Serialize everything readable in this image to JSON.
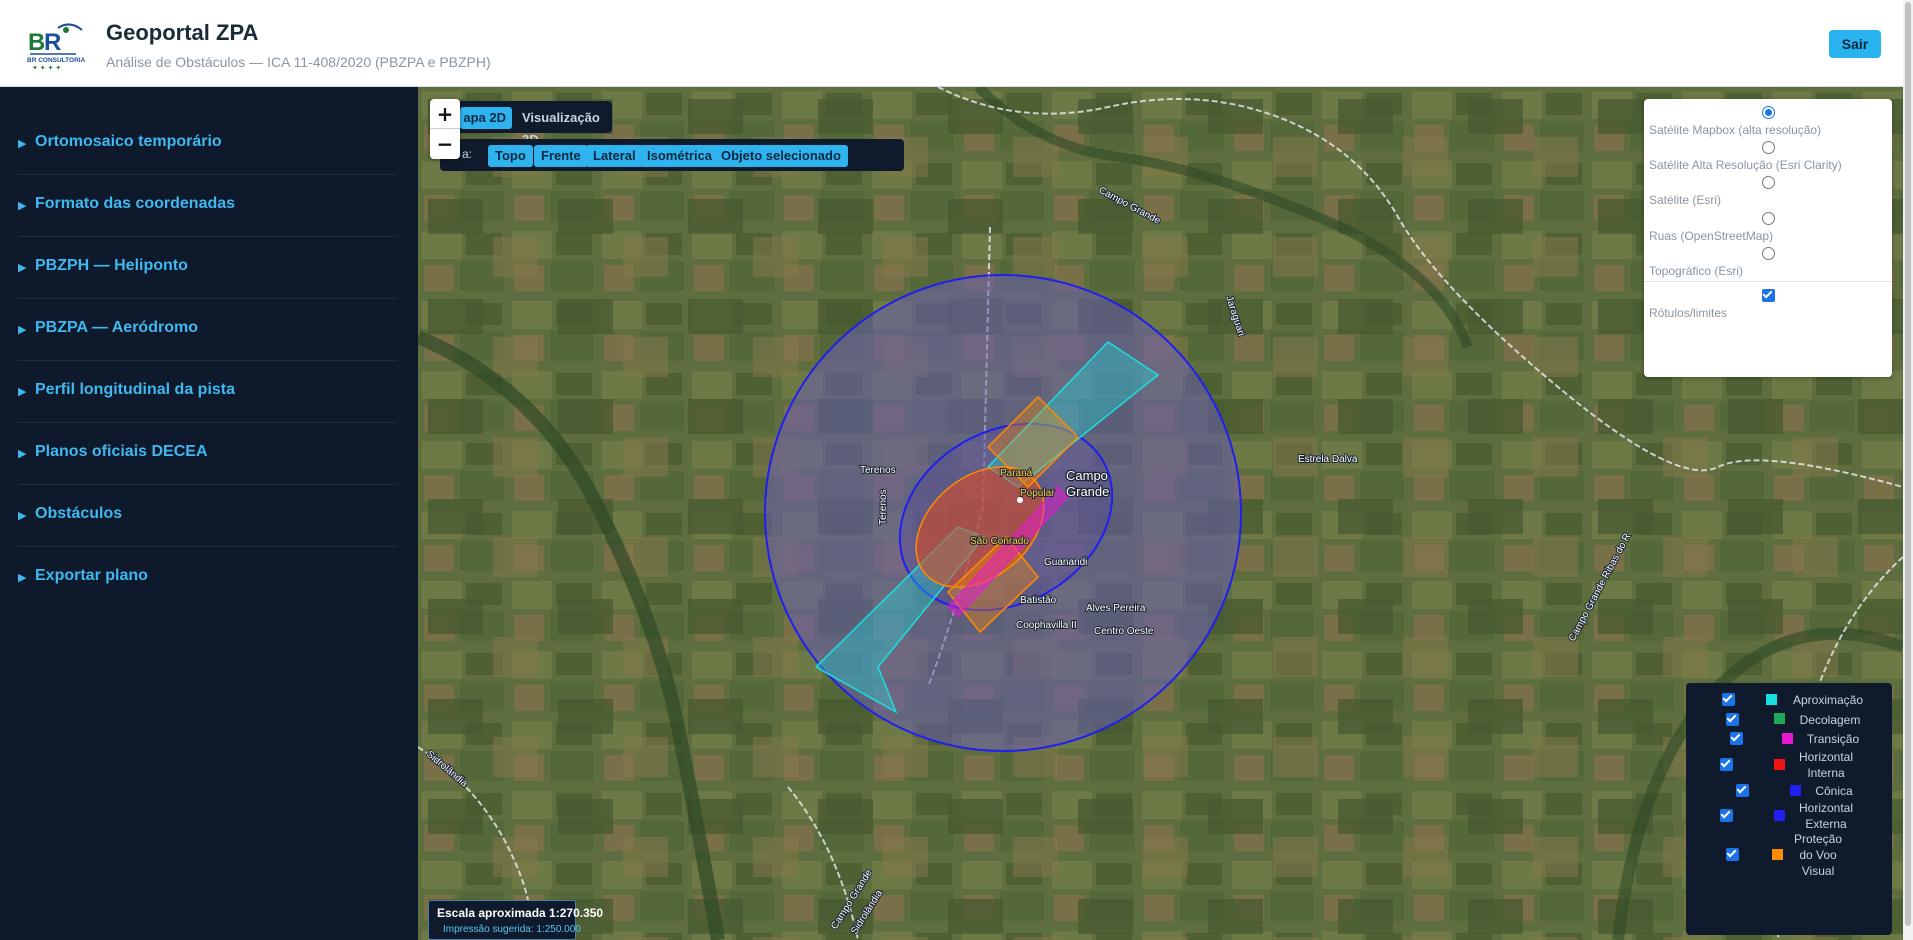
{
  "header": {
    "title": "Geoportal ZPA",
    "subtitle": "Análise de Obstáculos — ICA 11-408/2020 (PBZPA e PBZPH)",
    "logo_text": "BR CONSULTORIA",
    "logout_label": "Sair"
  },
  "sidebar": {
    "items": [
      {
        "label": "Ortomosaico temporário",
        "icon": "triangle-right-icon"
      },
      {
        "label": "Formato das coordenadas",
        "icon": "triangle-right-icon"
      },
      {
        "label": "PBZPH — Heliponto",
        "icon": "triangle-right-icon"
      },
      {
        "label": "PBZPA — Aeródromo",
        "icon": "triangle-right-icon"
      },
      {
        "label": "Perfil longitudinal da pista",
        "icon": "triangle-right-icon"
      },
      {
        "label": "Planos oficiais DECEA",
        "icon": "triangle-right-icon"
      },
      {
        "label": "Obstáculos",
        "icon": "triangle-right-icon"
      },
      {
        "label": "Exportar plano",
        "icon": "triangle-right-icon"
      }
    ]
  },
  "map": {
    "zoom_in": "+",
    "zoom_out": "−",
    "view_tabs": {
      "tab_2d": "apa 2D",
      "tab_3d": "Visualização 3D",
      "active": "2D"
    },
    "camera": {
      "prefix": "a:",
      "buttons": [
        "Topo",
        "Frente",
        "Lateral",
        "Isométrica",
        "Objeto selecionado"
      ]
    },
    "basemap": {
      "options": [
        {
          "label": "Satélite Mapbox (alta resolução)",
          "selected": true
        },
        {
          "label": "Satélite Alta Resolução (Esri Clarity)",
          "selected": false
        },
        {
          "label": "Satélite (Esri)",
          "selected": false
        },
        {
          "label": "Ruas (OpenStreetMap)",
          "selected": false
        },
        {
          "label": "Topográfico (Esri)",
          "selected": false
        }
      ],
      "labels_toggle": {
        "label": "Rótulos/limites",
        "checked": true
      }
    },
    "legend": {
      "items": [
        {
          "label": "Aproximação",
          "color": "#19e0e0",
          "checked": true
        },
        {
          "label": "Decolagem",
          "color": "#1ea85a",
          "checked": true
        },
        {
          "label": "Transição",
          "color": "#e619d0",
          "checked": true
        },
        {
          "label": "Horizontal Interna",
          "color": "#f01414",
          "checked": true
        },
        {
          "label": "Cônica",
          "color": "#1f1ff0",
          "checked": true
        },
        {
          "label": "Horizontal Externa",
          "color": "#1f1ff0",
          "checked": true
        },
        {
          "label": "Proteção do Voo Visual",
          "color": "#ff8c00",
          "checked": true
        }
      ]
    },
    "scale": {
      "main": "Escala aproximada 1:270.350",
      "sub": "Impressão sugerida: 1:250.000"
    },
    "place_labels": {
      "campo_grande_city_1": "Campo",
      "campo_grande_city_2": "Grande",
      "estrela_dalva": "Estrela Dalva",
      "terenos_city": "Terenos",
      "terenos_road": "Terenos",
      "parana": "Paraná",
      "popular": "Popular",
      "sao_conrado": "São Conrado",
      "guanandi": "Guanandi",
      "batistao": "Batistão",
      "alves_pereira": "Alves Pereira",
      "coophavilla": "Coophavilla II",
      "centro_oeste": "Centro Oeste",
      "campo_grande_road_top": "Campo Grande",
      "jaraguari": "Jaraguari",
      "sidrolandia_left": "Sidrolândia",
      "campo_grande_road_bottom": "Campo Grande",
      "sidrolandia_bottom": "Sidrolândia",
      "campo_grande_ribas": "Campo Grande Ribas do R"
    },
    "colors": {
      "conical": "#1f1ff0",
      "approach": "#19e0e0",
      "visual_flight": "#ff8c00",
      "horizontal_inner": "#f01414",
      "transition": "#e619d0"
    }
  }
}
